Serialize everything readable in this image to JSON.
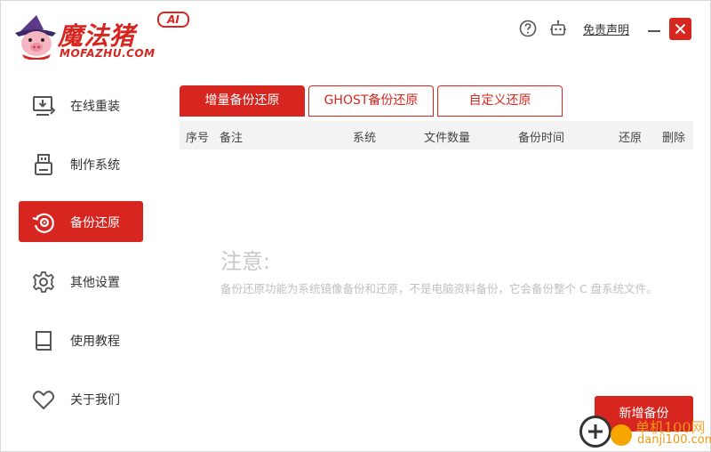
{
  "app": {
    "logo_title": "魔法猪",
    "logo_sub": "MOFAZHU.COM",
    "logo_badge": "AI"
  },
  "header": {
    "help_icon": "question-circle-icon",
    "robot_icon": "robot-icon",
    "disclaimer": "免责声明",
    "minimize_icon": "minimize-icon",
    "close_icon": "close-icon"
  },
  "sidebar": {
    "items": [
      {
        "label": "在线重装",
        "icon": "monitor-download-icon",
        "active": false
      },
      {
        "label": "制作系统",
        "icon": "usb-drive-icon",
        "active": false
      },
      {
        "label": "备份还原",
        "icon": "backup-restore-icon",
        "active": true
      },
      {
        "label": "其他设置",
        "icon": "gear-icon",
        "active": false
      },
      {
        "label": "使用教程",
        "icon": "book-icon",
        "active": false
      },
      {
        "label": "关于我们",
        "icon": "heart-icon",
        "active": false
      }
    ]
  },
  "tabs": [
    {
      "label": "增量备份还原",
      "active": true
    },
    {
      "label": "GHOST备份还原",
      "active": false
    },
    {
      "label": "自定义还原",
      "active": false
    }
  ],
  "table": {
    "columns": [
      "序号",
      "备注",
      "系统",
      "文件数量",
      "备份时间",
      "还原",
      "删除"
    ],
    "rows": []
  },
  "notice": {
    "title": "注意:",
    "text": "备份还原功能为系统镜像备份和还原，不是电脑资料备份，它会备份整个 C 盘系统文件。"
  },
  "actions": {
    "new_backup": "新增备份"
  },
  "watermark": {
    "text": "单机100网",
    "url": "danji100.com"
  },
  "colors": {
    "accent": "#d7261f",
    "header_bg": "#f3f3f3",
    "notice_text": "#c0c0c0"
  }
}
